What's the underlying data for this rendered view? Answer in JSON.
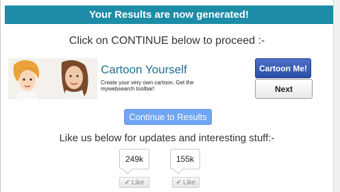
{
  "banner": {
    "title": "Your Results are now generated!"
  },
  "prompt": {
    "text": "Click on CONTINUE below to proceed :-"
  },
  "ad": {
    "title": "Cartoon Yourself",
    "description": "Create your very own cartoon. Get the mywebsearch toolbar!",
    "primary_button": "Cartoon Me!",
    "secondary_button": "Next"
  },
  "continue_button": {
    "label": "Continue to Results"
  },
  "social": {
    "text": "Like us below for updates and interesting stuff:-",
    "items": [
      {
        "count": "249k",
        "like_label": "Like",
        "check_icon": "check-icon"
      },
      {
        "count": "155k",
        "like_label": "Like",
        "check_icon": "check-icon"
      }
    ]
  },
  "colors": {
    "banner": "#1d8ca7",
    "ad_title": "#1e6f8c",
    "primary_button": "#2b4ea6",
    "continue_button": "#6fa5f3"
  }
}
